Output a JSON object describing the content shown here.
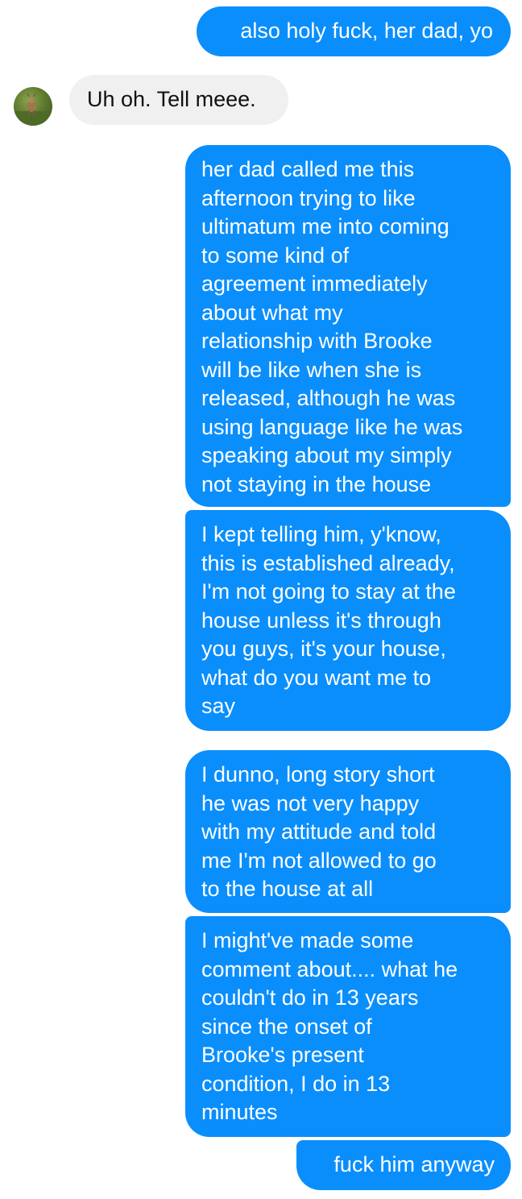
{
  "conversation": {
    "messages": [
      {
        "sender": "me",
        "text": "also holy fuck, her dad, yo"
      },
      {
        "sender": "contact",
        "text": "Uh oh. Tell meee."
      },
      {
        "sender": "me",
        "text": "her dad called me this\nafternoon trying to like\nultimatum me into coming\nto some kind of\nagreement immediately\nabout what my\nrelationship with Brooke\nwill be like when she is\nreleased, although he was\nusing language like he was\nspeaking about my simply\nnot staying in the house"
      },
      {
        "sender": "me",
        "text": "I kept telling him, y'know,\nthis is established already,\nI'm not going to stay at the\nhouse unless it's through\nyou guys, it's your house,\nwhat do you want me to\nsay"
      },
      {
        "sender": "me",
        "text": "I dunno, long story short\nhe was not very happy\nwith my attitude and told\nme I'm not allowed to go\nto the house at all"
      },
      {
        "sender": "me",
        "text": "I might've made some\ncomment about.... what he\ncouldn't do in 13 years\nsince the onset of\nBrooke's present\ncondition, I do in 13\nminutes"
      },
      {
        "sender": "me",
        "text": "fuck him anyway"
      }
    ],
    "contact_avatar": "contact-avatar-photo"
  },
  "colors": {
    "outgoing_bubble": "#0a8efc",
    "incoming_bubble": "#f0f0f0",
    "background": "#ffffff"
  }
}
